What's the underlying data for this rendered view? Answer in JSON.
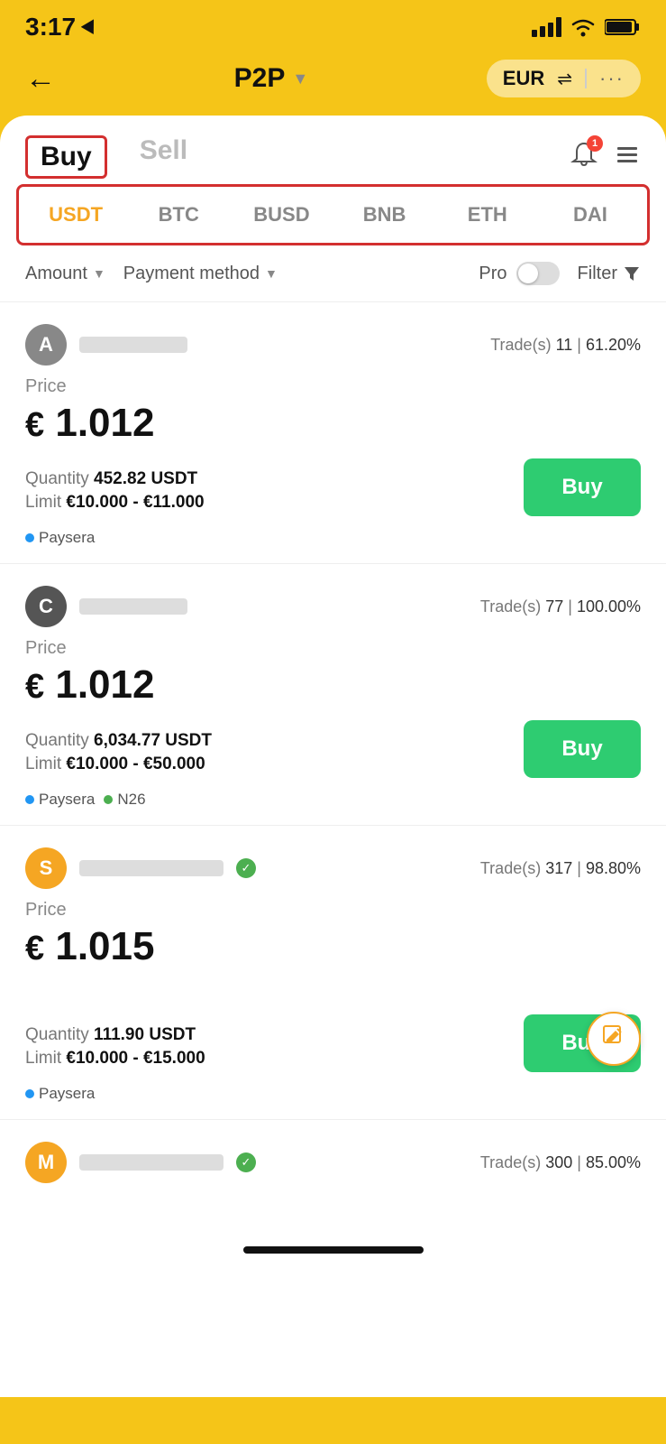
{
  "status": {
    "time": "3:17",
    "location_icon": "location-arrow"
  },
  "header": {
    "back_label": "←",
    "title": "P2P",
    "currency": "EUR",
    "more": "···"
  },
  "tabs": {
    "buy_label": "Buy",
    "sell_label": "Sell"
  },
  "crypto_tabs": [
    {
      "symbol": "USDT",
      "active": true
    },
    {
      "symbol": "BTC",
      "active": false
    },
    {
      "symbol": "BUSD",
      "active": false
    },
    {
      "symbol": "BNB",
      "active": false
    },
    {
      "symbol": "ETH",
      "active": false
    },
    {
      "symbol": "DAI",
      "active": false
    }
  ],
  "filters": {
    "amount_label": "Amount",
    "payment_method_label": "Payment method",
    "pro_label": "Pro",
    "filter_label": "Filter"
  },
  "trades": [
    {
      "avatar_letter": "A",
      "avatar_class": "avatar-a",
      "trades_count": "11",
      "trade_rate": "61.20%",
      "price_label": "Price",
      "price": "1.012",
      "currency": "€",
      "quantity_label": "Quantity",
      "quantity": "452.82 USDT",
      "limit_label": "Limit",
      "limit": "€10.000 - €11.000",
      "buy_label": "Buy",
      "payments": [
        "Paysera"
      ],
      "payment_dots": [
        "blue"
      ],
      "verified": false
    },
    {
      "avatar_letter": "C",
      "avatar_class": "avatar-c",
      "trades_count": "77",
      "trade_rate": "100.00%",
      "price_label": "Price",
      "price": "1.012",
      "currency": "€",
      "quantity_label": "Quantity",
      "quantity": "6,034.77 USDT",
      "limit_label": "Limit",
      "limit": "€10.000 - €50.000",
      "buy_label": "Buy",
      "payments": [
        "Paysera",
        "N26"
      ],
      "payment_dots": [
        "blue",
        "green"
      ],
      "verified": false
    },
    {
      "avatar_letter": "S",
      "avatar_class": "avatar-s",
      "trades_count": "317",
      "trade_rate": "98.80%",
      "price_label": "Price",
      "price": "1.015",
      "currency": "€",
      "quantity_label": "Quantity",
      "quantity": "111.90 USDT",
      "limit_label": "Limit",
      "limit": "€10.000 - €15.000",
      "buy_label": "Buy",
      "payments": [
        "Paysera"
      ],
      "payment_dots": [
        "blue"
      ],
      "verified": true
    },
    {
      "avatar_letter": "M",
      "avatar_class": "avatar-m",
      "trades_count": "300",
      "trade_rate": "85.00%",
      "verified": true,
      "partial": true
    }
  ]
}
